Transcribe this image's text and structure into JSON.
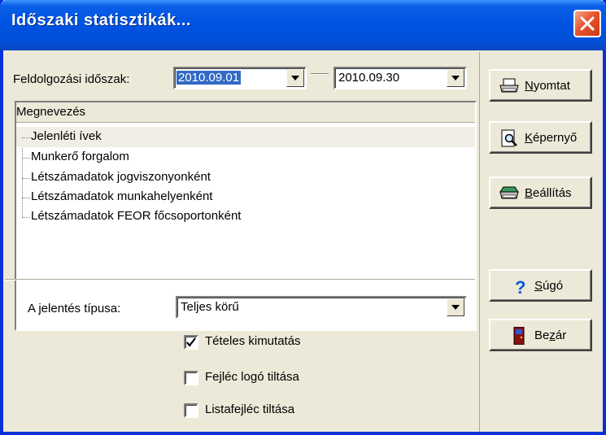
{
  "window": {
    "title": "Időszaki statisztikák..."
  },
  "period": {
    "label": "Feldolgozási időszak:",
    "from": "2010.09.01",
    "to": "2010.09.30"
  },
  "list": {
    "header": "Megnevezés",
    "items": [
      "Jelenléti ívek",
      "Munkerő forgalom",
      "Létszámadatok jogviszonyonként",
      "Létszámadatok munkahelyenként",
      "Létszámadatok FEOR főcsoportonként"
    ],
    "selected_index": 0
  },
  "report_type": {
    "label": "A jelentés típusa:",
    "value": "Teljes körű"
  },
  "options": [
    {
      "label": "Tételes kimutatás",
      "checked": true
    },
    {
      "label": "Fejléc logó tiltása",
      "checked": false
    },
    {
      "label": "Listafejléc tiltása",
      "checked": false
    }
  ],
  "buttons": {
    "print": {
      "mnemonic": "N",
      "rest": "yomtat",
      "icon": "printer-icon"
    },
    "screen": {
      "mnemonic": "K",
      "rest": "épernyő",
      "icon": "print-preview-icon"
    },
    "settings": {
      "mnemonic": "B",
      "rest": "eállítás",
      "icon": "printer-settings-icon"
    },
    "help": {
      "mnemonic": "S",
      "rest": "úgó",
      "icon": "question-mark-icon"
    },
    "close": {
      "pre": "Be",
      "mnemonic": "z",
      "rest": "ár",
      "icon": "door-exit-icon"
    }
  },
  "colors": {
    "titlebar": "#0054e3",
    "selection": "#316ac5",
    "face": "#ece9d8",
    "close": "#e8552e"
  }
}
